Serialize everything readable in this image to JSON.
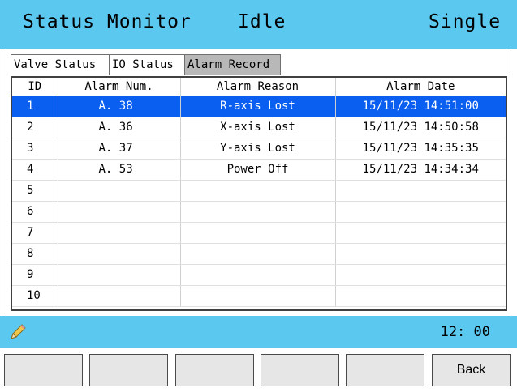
{
  "header": {
    "title": "Status Monitor",
    "state": "Idle",
    "mode": "Single"
  },
  "tabs": [
    {
      "label": "Valve Status",
      "active": false
    },
    {
      "label": "IO Status",
      "active": false
    },
    {
      "label": "Alarm Record",
      "active": true
    }
  ],
  "table": {
    "columns": [
      "ID",
      "Alarm Num.",
      "Alarm Reason",
      "Alarm Date"
    ],
    "rows": [
      {
        "id": "1",
        "num": "A. 38",
        "reason": "R-axis Lost",
        "date": "15/11/23 14:51:00",
        "selected": true
      },
      {
        "id": "2",
        "num": "A. 36",
        "reason": "X-axis Lost",
        "date": "15/11/23 14:50:58"
      },
      {
        "id": "3",
        "num": "A. 37",
        "reason": "Y-axis Lost",
        "date": "15/11/23 14:35:35"
      },
      {
        "id": "4",
        "num": "A. 53",
        "reason": "Power Off",
        "date": "15/11/23 14:34:34"
      },
      {
        "id": "5",
        "num": "",
        "reason": "",
        "date": ""
      },
      {
        "id": "6",
        "num": "",
        "reason": "",
        "date": ""
      },
      {
        "id": "7",
        "num": "",
        "reason": "",
        "date": ""
      },
      {
        "id": "8",
        "num": "",
        "reason": "",
        "date": ""
      },
      {
        "id": "9",
        "num": "",
        "reason": "",
        "date": ""
      },
      {
        "id": "10",
        "num": "",
        "reason": "",
        "date": ""
      }
    ]
  },
  "status_bar": {
    "time": "12: 00",
    "icon": "pencil-icon"
  },
  "buttons": [
    "",
    "",
    "",
    "",
    "",
    "Back"
  ],
  "colors": {
    "header_bg": "#5bc8f0",
    "selected_row": "#0a5ff0",
    "active_tab": "#b8b8b8",
    "button_bg": "#e6e6e6"
  }
}
